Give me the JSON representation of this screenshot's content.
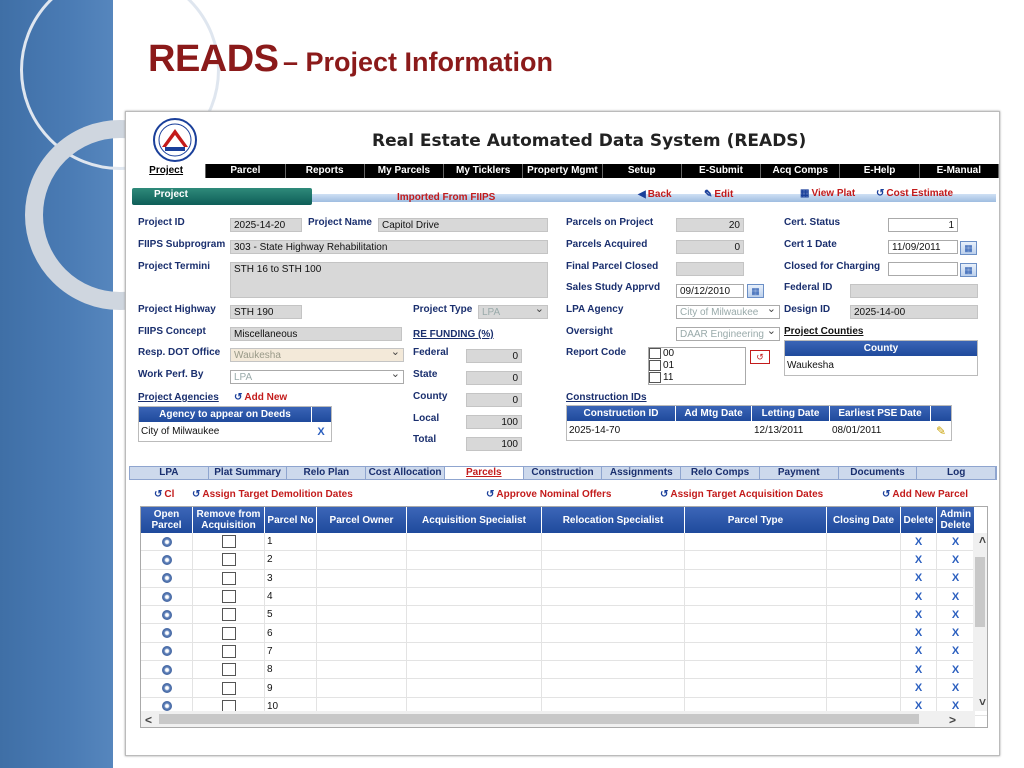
{
  "slide": {
    "title_main": "READS",
    "title_sub": "– Project Information"
  },
  "app": {
    "title": "Real Estate Automated Data System (READS)"
  },
  "topnav": [
    "Project",
    "Parcel",
    "Reports",
    "My Parcels",
    "My Ticklers",
    "Property Mgmt",
    "Setup",
    "E-Submit",
    "Acq Comps",
    "E-Help",
    "E-Manual"
  ],
  "bar": {
    "project_tab": "Project",
    "imported": "Imported From FIIPS",
    "back": "Back",
    "edit": "Edit",
    "view_plat": "View Plat",
    "cost_estimate": "Cost Estimate"
  },
  "form": {
    "project_id_label": "Project ID",
    "project_id": "2025-14-20",
    "project_name_label": "Project Name",
    "project_name": "Capitol Drive",
    "fiips_sub_label": "FIIPS Subprogram",
    "fiips_sub": "303 - State Highway Rehabilitation",
    "termini_label": "Project Termini",
    "termini": "STH 16 to STH 100",
    "highway_label": "Project Highway",
    "highway": "STH 190",
    "type_label": "Project Type",
    "type": "LPA",
    "concept_label": "FIIPS Concept",
    "concept": "Miscellaneous",
    "re_funding_label": "RE FUNDING (%)",
    "dot_office_label": "Resp. DOT Office",
    "dot_office": "Waukesha",
    "federal_label": "Federal",
    "federal": "0",
    "work_perf_label": "Work Perf. By",
    "work_perf": "LPA",
    "state_label": "State",
    "state": "0",
    "county_label": "County",
    "county": "0",
    "local_label": "Local",
    "local": "100",
    "total_label": "Total",
    "total": "100",
    "parcels_on_project_label": "Parcels on Project",
    "parcels_on_project": "20",
    "parcels_acquired_label": "Parcels Acquired",
    "parcels_acquired": "0",
    "final_parcel_closed_label": "Final Parcel Closed",
    "final_parcel_closed": "",
    "sales_study_label": "Sales Study Apprvd",
    "sales_study": "09/12/2010",
    "lpa_agency_label": "LPA Agency",
    "lpa_agency": "City of Milwaukee",
    "oversight_label": "Oversight",
    "oversight": "DAAR Engineering",
    "report_code_label": "Report Code",
    "report_codes": [
      "00",
      "01",
      "11"
    ],
    "cert_status_label": "Cert. Status",
    "cert_status": "1",
    "cert1_date_label": "Cert 1 Date",
    "cert1_date": "11/09/2011",
    "closed_charging_label": "Closed for Charging",
    "closed_charging": "",
    "federal_id_label": "Federal ID",
    "federal_id": "",
    "design_id_label": "Design ID",
    "design_id": "2025-14-00",
    "project_counties_label": "Project Counties",
    "county_header": "County",
    "county_value": "Waukesha",
    "agencies_label": "Project Agencies",
    "add_new": "Add New",
    "agency_header": "Agency to appear on Deeds",
    "agency_value": "City of Milwaukee",
    "construction_ids_label": "Construction IDs",
    "construction_headers": [
      "Construction ID",
      "Ad Mtg Date",
      "Letting Date",
      "Earliest PSE Date"
    ],
    "construction_row": [
      "2025-14-70",
      "",
      "12/13/2011",
      "08/01/2011"
    ]
  },
  "tabs": [
    "LPA",
    "Plat Summary",
    "Relo Plan",
    "Cost Allocation",
    "Parcels",
    "Construction",
    "Assignments",
    "Relo Comps",
    "Payment",
    "Documents",
    "Log"
  ],
  "actions": {
    "ci": "Cl",
    "assign_demo": "Assign Target Demolition Dates",
    "approve_nominal": "Approve Nominal Offers",
    "assign_acq": "Assign Target Acquisition Dates",
    "add_parcel": "Add New Parcel"
  },
  "grid": {
    "headers": [
      "Open Parcel",
      "Remove from Acquisition",
      "Parcel No",
      "Parcel Owner",
      "Acquisition Specialist",
      "Relocation Specialist",
      "Parcel Type",
      "Closing Date",
      "Delete",
      "Admin Delete"
    ],
    "rows": [
      "1",
      "2",
      "3",
      "4",
      "5",
      "6",
      "7",
      "8",
      "9",
      "10"
    ],
    "delete_mark": "X"
  }
}
